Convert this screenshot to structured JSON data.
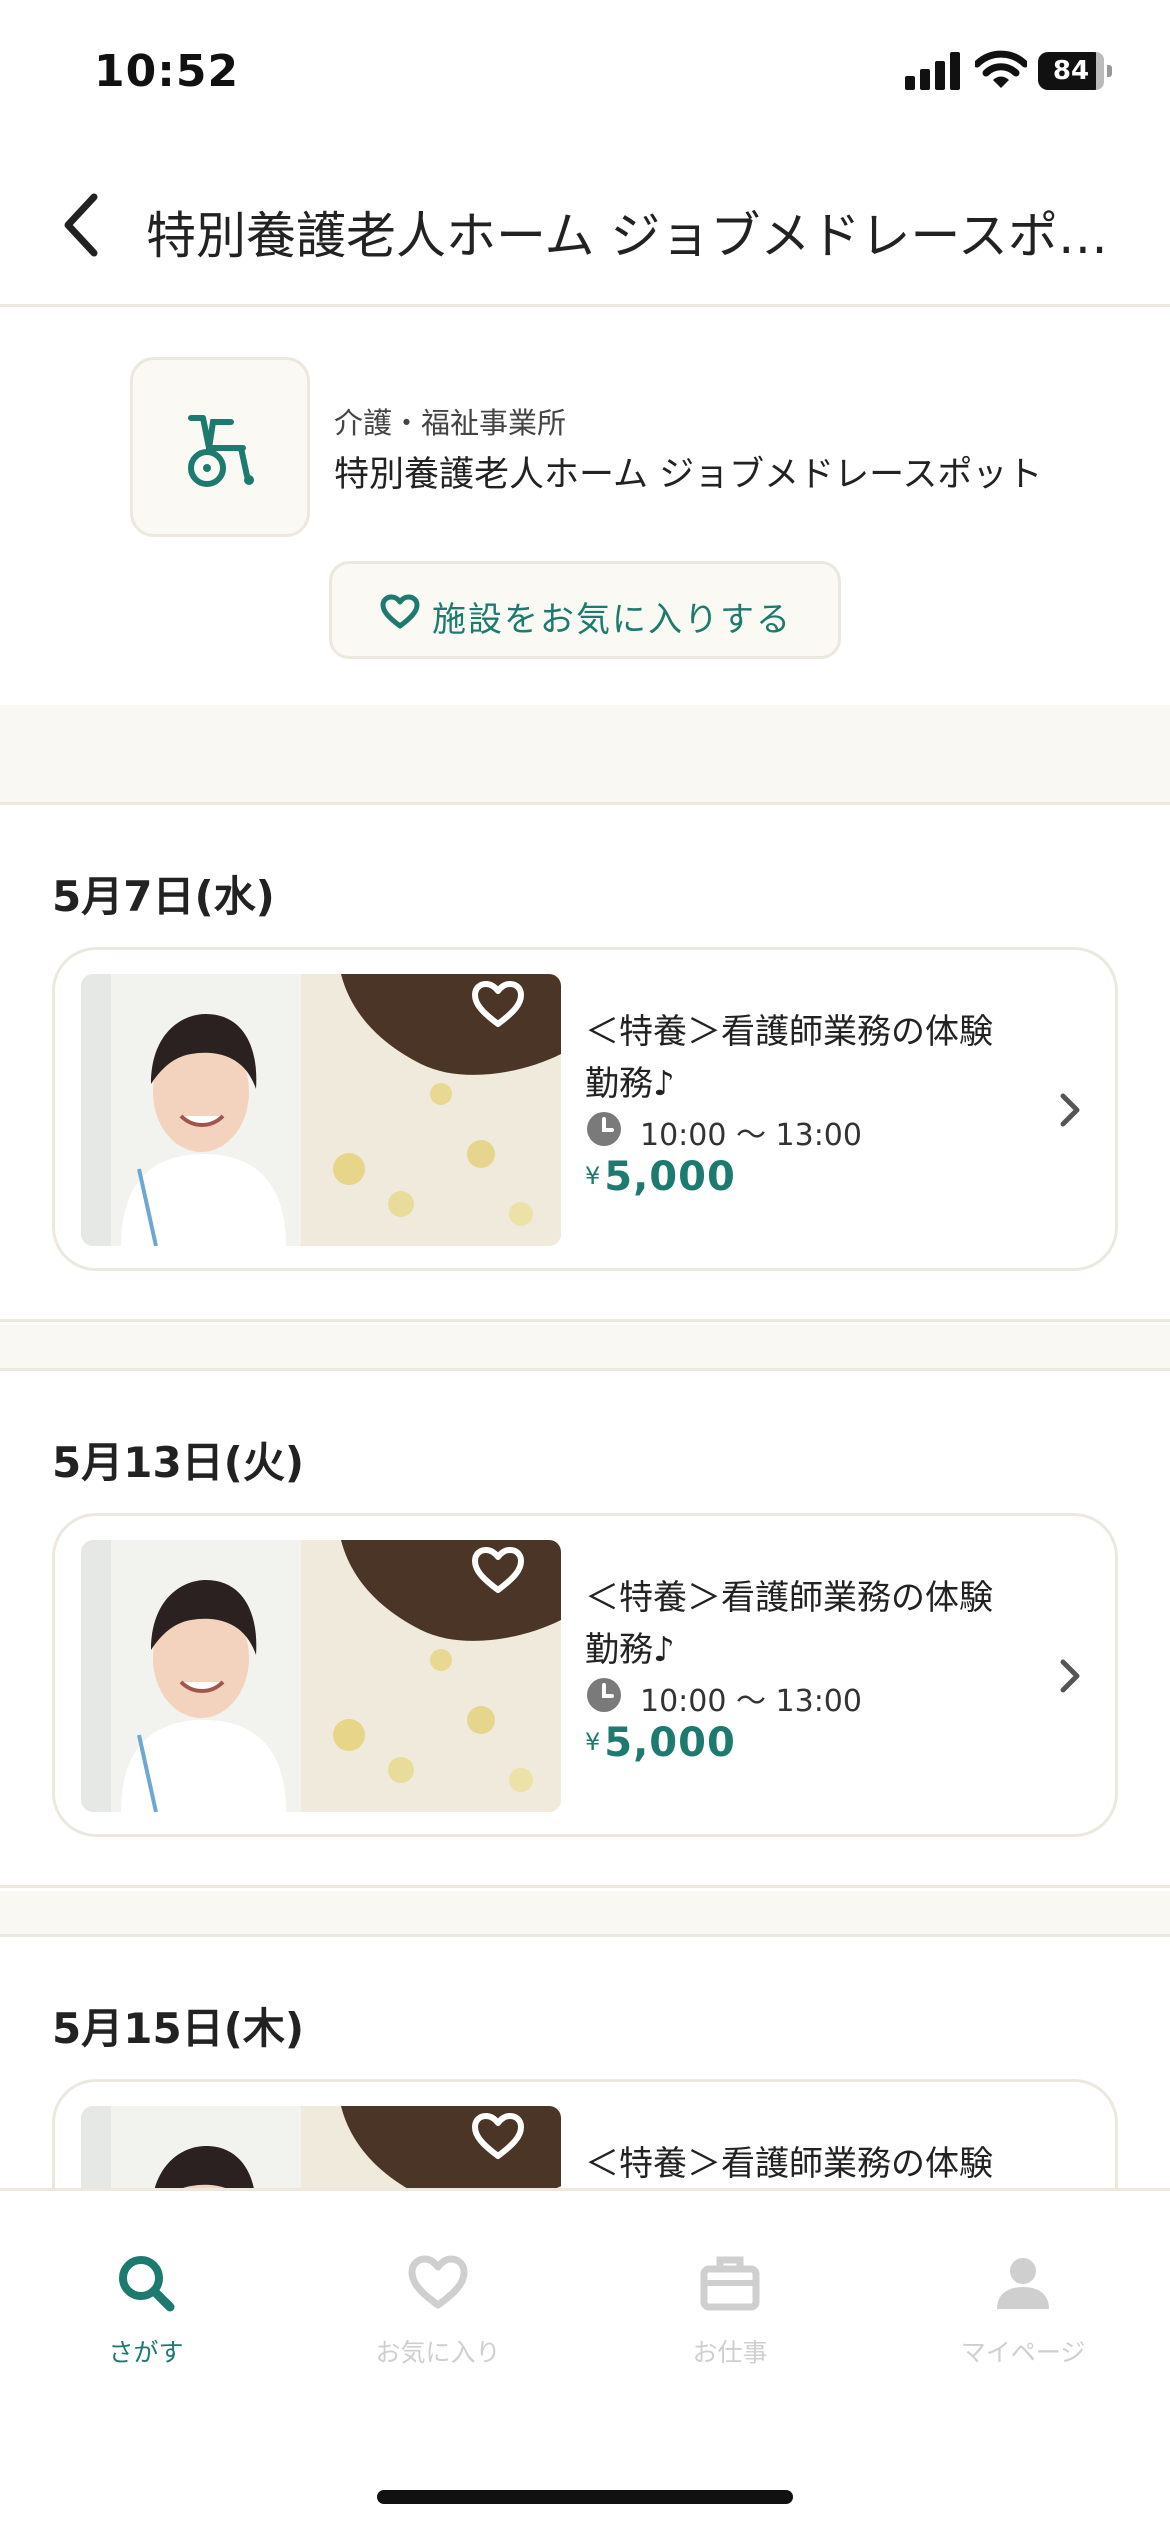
{
  "status": {
    "time": "10:52",
    "battery": "84"
  },
  "nav": {
    "title": "特別養護老人ホーム ジョブメドレースポ…"
  },
  "facility": {
    "category": "介護・福祉事業所",
    "name": "特別養護老人ホーム ジョブメドレースポット",
    "favorite_label": "施設をお気に入りする"
  },
  "days": [
    {
      "date": "5月7日(水)",
      "job": {
        "title": "＜特養＞看護師業務の体験勤務♪",
        "time": "10:00 〜 13:00",
        "currency": "¥",
        "wage": "5,000"
      }
    },
    {
      "date": "5月13日(火)",
      "job": {
        "title": "＜特養＞看護師業務の体験勤務♪",
        "time": "10:00 〜 13:00",
        "currency": "¥",
        "wage": "5,000"
      }
    },
    {
      "date": "5月15日(木)",
      "job": {
        "title": "＜特養＞看護師業務の体験",
        "time": "",
        "currency": "",
        "wage": ""
      }
    }
  ],
  "tabs": [
    {
      "label": "さがす",
      "icon": "search-icon",
      "active": true
    },
    {
      "label": "お気に入り",
      "icon": "heart-icon",
      "active": false
    },
    {
      "label": "お仕事",
      "icon": "briefcase-icon",
      "active": false
    },
    {
      "label": "マイページ",
      "icon": "person-icon",
      "active": false
    }
  ],
  "colors": {
    "accent": "#1c7a6e",
    "border": "#ece8de",
    "beige": "#faf8f2",
    "inactive": "#cfcfcf"
  }
}
